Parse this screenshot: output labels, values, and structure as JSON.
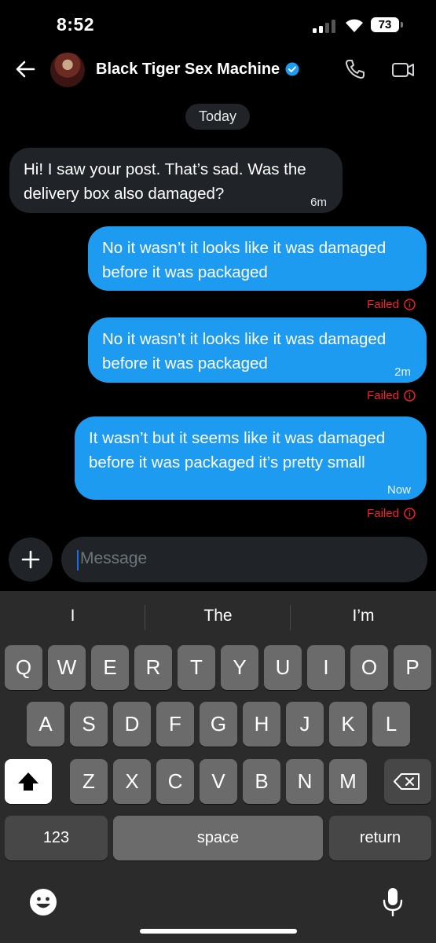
{
  "status_bar": {
    "time": "8:52",
    "battery": "73"
  },
  "header": {
    "name": "Black Tiger Sex Machine"
  },
  "date_divider": "Today",
  "messages": [
    {
      "direction": "incoming",
      "text": "Hi! I saw your post. That’s sad. Was the\ndelivery box also damaged?",
      "time": "6m"
    },
    {
      "direction": "outgoing",
      "text": "No it wasn’t it looks like it was damaged\nbefore it was packaged",
      "time": "",
      "status": "Failed"
    },
    {
      "direction": "outgoing",
      "text": "No it wasn’t it looks like it was damaged\nbefore it was packaged",
      "time": "2m",
      "status": "Failed"
    },
    {
      "direction": "outgoing",
      "text": "It wasn’t but it seems like it was damaged\nbefore it was packaged it’s pretty small",
      "time": "Now",
      "status": "Failed"
    }
  ],
  "composer": {
    "placeholder": "Message"
  },
  "keyboard": {
    "suggestions": [
      "I",
      "The",
      "I’m"
    ],
    "row1": [
      "Q",
      "W",
      "E",
      "R",
      "T",
      "Y",
      "U",
      "I",
      "O",
      "P"
    ],
    "row2": [
      "A",
      "S",
      "D",
      "F",
      "G",
      "H",
      "J",
      "K",
      "L"
    ],
    "row3": [
      "Z",
      "X",
      "C",
      "V",
      "B",
      "N",
      "M"
    ],
    "numbers_key": "123",
    "space_key": "space",
    "return_key": "return"
  },
  "colors": {
    "accent": "#1d9bf0",
    "failed": "#f4212e",
    "bubble_incoming": "#202327"
  }
}
